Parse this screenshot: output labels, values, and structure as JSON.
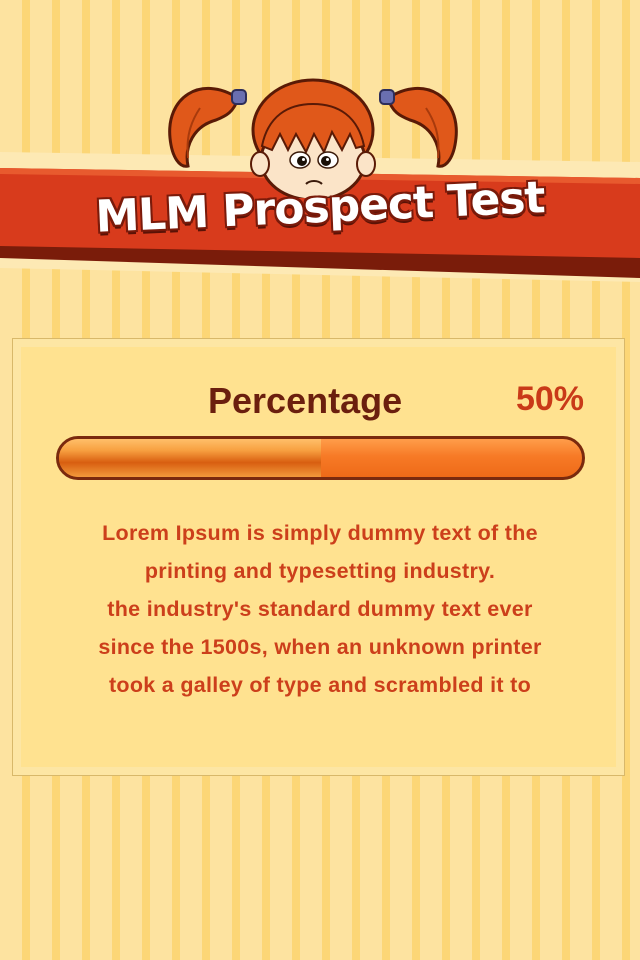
{
  "app": {
    "title": "MLM Prospect Test"
  },
  "progress": {
    "label": "Percentage",
    "value_text": "50%",
    "value": 0.5
  },
  "description": {
    "lines": [
      "Lorem Ipsum is simply dummy text of the",
      "printing and typesetting industry.",
      "the industry's standard dummy text ever",
      "since the 1500s, when an unknown printer",
      "took a galley of type and scrambled it to"
    ]
  },
  "colors": {
    "background": "#fde08a",
    "banner": "#d83b1c",
    "banner_shadow": "#7a1c0a",
    "title_text": "#ffffff",
    "label_text": "#6b1f0e",
    "accent": "#c93a18",
    "progress_orange": "#f77a26",
    "body_text": "#cc3f1b"
  },
  "icons": {
    "mascot": "cartoon-girl-pigtails-icon"
  }
}
